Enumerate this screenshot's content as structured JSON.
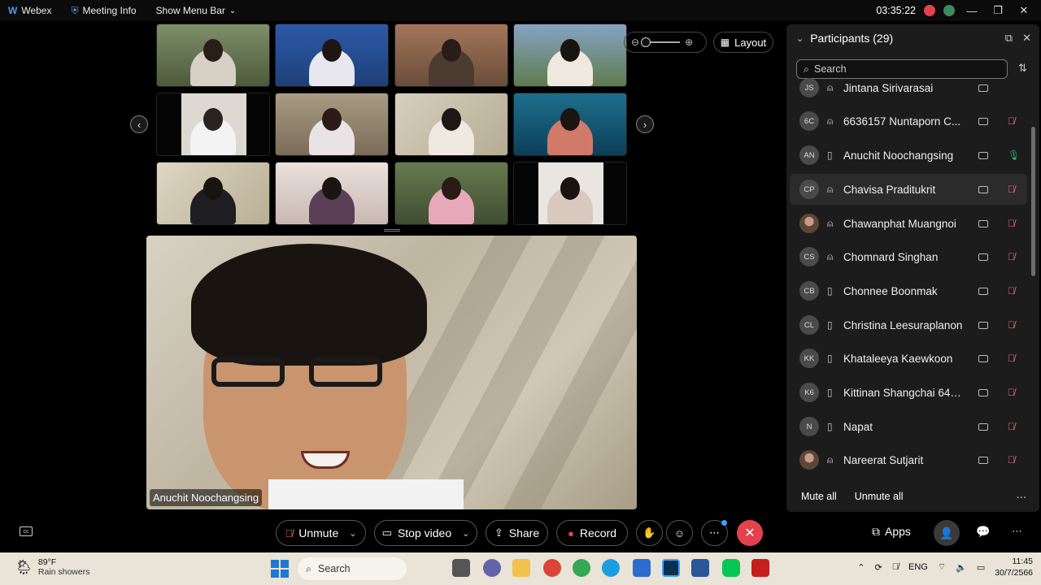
{
  "titlebar": {
    "app_name": "Webex",
    "meeting_info": "Meeting Info",
    "show_menu_bar": "Show Menu Bar",
    "timer": "03:35:22"
  },
  "stage": {
    "layout_label": "Layout",
    "active_speaker": "Anuchit Noochangsing"
  },
  "participants": {
    "title": "Participants (29)",
    "search_placeholder": "Search",
    "mute_all": "Mute all",
    "unmute_all": "Unmute all",
    "list": [
      {
        "initials": "JS",
        "name": "Jintana Sirivarasai",
        "device": "headset",
        "mic": "none"
      },
      {
        "initials": "6C",
        "name": "6636157 Nuntaporn C...",
        "device": "headset",
        "mic": "muted"
      },
      {
        "initials": "AN",
        "name": "Anuchit Noochangsing",
        "device": "phone",
        "mic": "on"
      },
      {
        "initials": "CP",
        "name": "Chavisa Praditukrit",
        "device": "headset",
        "mic": "muted"
      },
      {
        "initials": "",
        "name": "Chawanphat Muangnoi",
        "device": "headset",
        "mic": "muted"
      },
      {
        "initials": "CS",
        "name": "Chomnard Singhan",
        "device": "headset",
        "mic": "muted"
      },
      {
        "initials": "CB",
        "name": "Chonnee Boonmak",
        "device": "phone",
        "mic": "muted"
      },
      {
        "initials": "CL",
        "name": "Christina Leesuraplanon",
        "device": "phone",
        "mic": "muted"
      },
      {
        "initials": "KK",
        "name": "Khataleeya Kaewkoon",
        "device": "phone",
        "mic": "muted"
      },
      {
        "initials": "K6",
        "name": "Kittinan Shangchai 643...",
        "device": "phone",
        "mic": "muted"
      },
      {
        "initials": "N",
        "name": "Napat",
        "device": "phone",
        "mic": "muted"
      },
      {
        "initials": "",
        "name": "Nareerat Sutjarit",
        "device": "headset",
        "mic": "muted"
      }
    ]
  },
  "controls": {
    "unmute": "Unmute",
    "stop_video": "Stop video",
    "share": "Share",
    "record": "Record",
    "apps": "Apps"
  },
  "taskbar": {
    "temperature": "89°F",
    "weather": "Rain showers",
    "search": "Search",
    "language": "ENG",
    "time": "11:45",
    "date": "30/7/2566"
  },
  "colors": {
    "end_call": "#e5414d",
    "mic_muted": "#f26b7a",
    "mic_on": "#2fb36b"
  }
}
